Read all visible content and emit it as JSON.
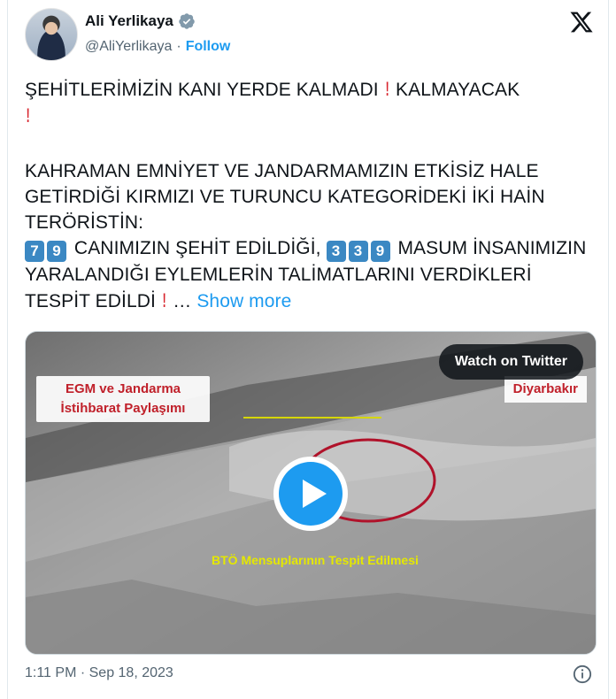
{
  "author": {
    "name": "Ali Yerlikaya",
    "handle": "@AliYerlikaya",
    "separator": "·",
    "follow_label": "Follow"
  },
  "icons": {
    "verified": "verified-badge-icon",
    "x_logo": "x-logo-icon",
    "play": "play-icon",
    "info": "info-icon"
  },
  "tweet": {
    "line1": "ŞEHİTLERİMİZİN KANI YERDE KALMADI",
    "line1b": " KALMAYACAK",
    "line2": "KAHRAMAN EMNİYET VE JANDARMAMIZIN ETKİSİZ HALE GETİRDİĞİ KIRMIZI VE TURUNCU KATEGORİDEKİ İKİ HAİN TERÖRİSTİN:",
    "num1a": "7",
    "num1b": "9",
    "line3": " CANIMIZIN ŞEHİT EDİLDİĞİ, ",
    "num2a": "3",
    "num2b": "3",
    "num2c": "9",
    "line4": " MASUM İNSANIMIZIN YARALANDIĞI EYLEMLERİN TALİMATLARINI VERDİKLERİ TESPİT EDİLDİ",
    "ellipsis": " … ",
    "show_more": "Show more",
    "exclamation": "!"
  },
  "media": {
    "watch_label": "Watch on Twitter",
    "left_label_1": "EGM ve Jandarma",
    "left_label_2": "İstihbarat Paylaşımı",
    "right_label": "Diyarbakır",
    "caption": "BTÖ Mensuplarının  Tespit Edilmesi"
  },
  "footer": {
    "timestamp": "1:11 PM · Sep 18, 2023"
  },
  "colors": {
    "link": "#1d9bf0",
    "exclamation": "#d8252e",
    "keycap": "#3b88c3"
  }
}
